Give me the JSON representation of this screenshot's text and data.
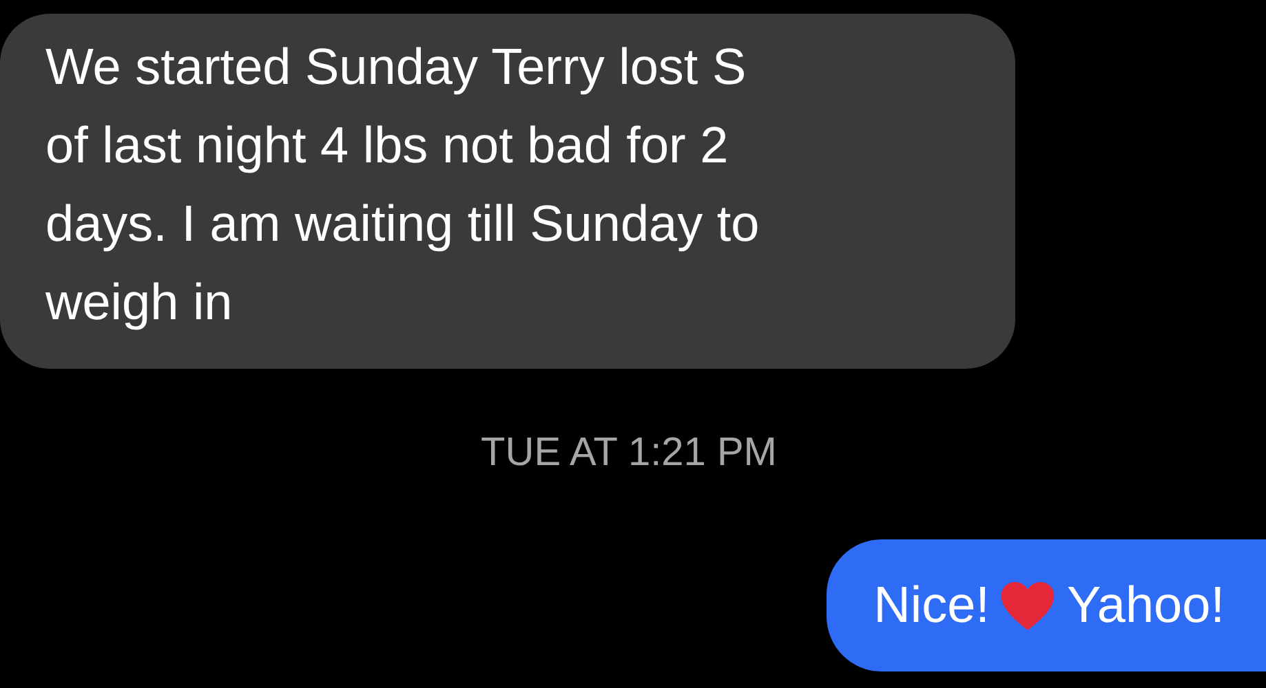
{
  "messages": [
    {
      "kind": "received",
      "lines": [
        "We started Sunday Terry lost S",
        "of last night 4 lbs not bad for 2",
        "days. I am waiting till Sunday to",
        "weigh in"
      ]
    },
    {
      "kind": "timestamp",
      "text": "TUE AT 1:21 PM"
    },
    {
      "kind": "sent",
      "before": "Nice!",
      "after": "Yahoo!"
    }
  ]
}
